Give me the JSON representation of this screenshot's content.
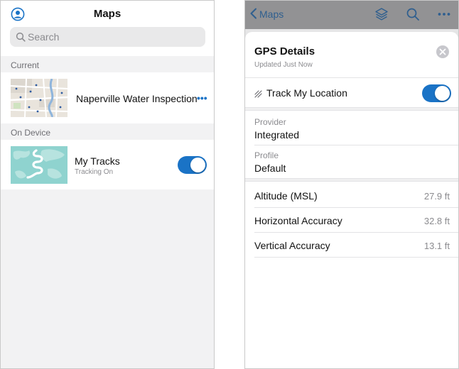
{
  "left": {
    "title": "Maps",
    "search": {
      "placeholder": "Search",
      "value": ""
    },
    "sections": {
      "current": "Current",
      "on_device": "On Device"
    },
    "current_map": {
      "title": "Naperville Water Inspection",
      "more_icon": "more-dots-icon",
      "more_label": "•••"
    },
    "device_map": {
      "title": "My Tracks",
      "subtitle": "Tracking On",
      "toggle_on": true
    }
  },
  "right": {
    "nav": {
      "back_label": "Maps",
      "icons": [
        "layers-icon",
        "search-icon",
        "more-icon"
      ]
    },
    "sheet": {
      "title": "GPS Details",
      "subtitle": "Updated Just Now",
      "track": {
        "label": "Track My Location",
        "on": true
      },
      "provider": {
        "label": "Provider",
        "value": "Integrated"
      },
      "profile": {
        "label": "Profile",
        "value": "Default"
      },
      "metrics": [
        {
          "label": "Altitude (MSL)",
          "value": "27.9 ft"
        },
        {
          "label": "Horizontal Accuracy",
          "value": "32.8 ft"
        },
        {
          "label": "Vertical Accuracy",
          "value": "13.1 ft"
        }
      ]
    }
  },
  "colors": {
    "accent": "#1a73c6",
    "nav_overlay": "#929294",
    "background": "#f2f2f3"
  }
}
